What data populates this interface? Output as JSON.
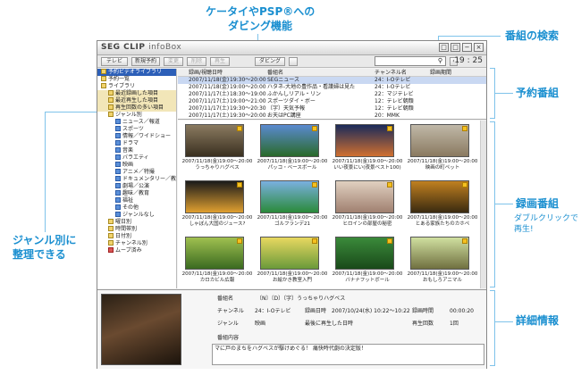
{
  "callouts": {
    "dubbing": [
      "ケータイやPSP®への",
      "ダビング機能"
    ],
    "search": "番組の検索",
    "reserved": "予約番組",
    "recorded": "録画番組",
    "recorded_sub": [
      "ダブルクリックで",
      "再生!"
    ],
    "genre": [
      "ジャンル別に",
      "整理できる"
    ],
    "detail": "詳細情報"
  },
  "app": {
    "logo_main": "SEG CLIP",
    "logo_sub": "infoBox",
    "clock": "19 : 25",
    "window_buttons": [
      "□",
      "□",
      "−",
      "×"
    ]
  },
  "toolbar": {
    "buttons": [
      "テレビ",
      "新規予約",
      "変更",
      "削除",
      "再生",
      "ダビング"
    ]
  },
  "tree": {
    "items": [
      {
        "label": "予約ビデオライブラリ",
        "style": "sel",
        "indent": 0
      },
      {
        "label": "予約一覧",
        "indent": 0
      },
      {
        "label": "ライブラリ",
        "indent": 0
      },
      {
        "label": "最近録画した項目",
        "style": "hl",
        "indent": 1
      },
      {
        "label": "最近再生した項目",
        "style": "hl",
        "indent": 1
      },
      {
        "label": "再生回数の多い項目",
        "style": "hl",
        "indent": 1
      },
      {
        "label": "ジャンル別",
        "indent": 1
      },
      {
        "label": "ニュース／報道",
        "indent": 2
      },
      {
        "label": "スポーツ",
        "indent": 2
      },
      {
        "label": "情報／ワイドショー",
        "indent": 2
      },
      {
        "label": "ドラマ",
        "indent": 2
      },
      {
        "label": "音楽",
        "indent": 2
      },
      {
        "label": "バラエティ",
        "indent": 2
      },
      {
        "label": "映画",
        "indent": 2
      },
      {
        "label": "アニメ／特撮",
        "indent": 2
      },
      {
        "label": "ドキュメンタリー／教養",
        "indent": 2
      },
      {
        "label": "劇場／公演",
        "indent": 2
      },
      {
        "label": "趣味／教育",
        "indent": 2
      },
      {
        "label": "福祉",
        "indent": 2
      },
      {
        "label": "その他",
        "indent": 2
      },
      {
        "label": "ジャンルなし",
        "indent": 2
      },
      {
        "label": "曜日別",
        "indent": 1
      },
      {
        "label": "時間帯別",
        "indent": 1
      },
      {
        "label": "日付別",
        "indent": 1
      },
      {
        "label": "チャンネル別",
        "indent": 1
      },
      {
        "label": "ムーブ済み",
        "indent": 1
      }
    ]
  },
  "reserved": {
    "headers": [
      "録画/視聴日時",
      "番組名",
      "チャンネル名",
      "録画期間"
    ],
    "rows": [
      [
        "2007/11/18(金)",
        "19:30〜20:00",
        "SEGニュース",
        "24：I-Oテレビ"
      ],
      [
        "2007/11/18(金)",
        "19:00〜20:00",
        "ハタネ-大地の豊作品・看護婦は見た",
        "24：I-Oテレビ"
      ],
      [
        "2007/11/17(土)",
        "18:30〜19:00",
        "ふかんしリアル・リン",
        "22：マジテレビ"
      ],
      [
        "2007/11/17(土)",
        "19:00〜21:00",
        "スポーツダイ・ボー",
        "12：テレビ朝顔"
      ],
      [
        "2007/11/17(土)",
        "19:30〜20:30",
        "〔字〕天気予報",
        "12：テレビ朝顔"
      ],
      [
        "2007/11/17(土)",
        "19:30〜20:00",
        "お天はPC講座",
        "20：MMK"
      ]
    ]
  },
  "recordings": [
    {
      "date": "2007/11/18(金)19:00〜20:00",
      "title": "うっちゃりハグベス"
    },
    {
      "date": "2007/11/18(金)19:00〜20:00",
      "title": "パッコ・ベースボール"
    },
    {
      "date": "2007/11/18(金)19:00〜20:00",
      "title": "いい夜景にい(夜景ベスト100)"
    },
    {
      "date": "2007/11/18(金)19:00〜20:00",
      "title": "映画の町ペット"
    },
    {
      "date": "2007/11/18(金)19:00〜20:00",
      "title": "しゃぼん大国のジュース?"
    },
    {
      "date": "2007/11/18(金)19:00〜20:00",
      "title": "ゴルフランデ21"
    },
    {
      "date": "2007/11/18(金)19:00〜20:00",
      "title": "ヒロインの部屋の秘密"
    },
    {
      "date": "2007/11/18(金)19:00〜20:00",
      "title": "とある家族たちのカホペ"
    },
    {
      "date": "2007/11/18(金)19:00〜20:00",
      "title": "カロカビル広報"
    },
    {
      "date": "2007/11/18(金)19:00〜20:00",
      "title": "お絵かき教室入門"
    },
    {
      "date": "2007/11/18(金)19:00〜20:00",
      "title": "バナナフットボール"
    },
    {
      "date": "2007/11/18(金)19:00〜20:00",
      "title": "おもしろアニマル"
    }
  ],
  "detail": {
    "title_label": "番組名",
    "title_value": "〔N〕〔D〕〔字〕うっちゃりハグベス",
    "channel_label": "チャンネル",
    "channel_value": "24：I-Oテレビ",
    "recdate_label": "録画日時",
    "recdate_value": "2007/10/24(水) 10:22〜10:22",
    "duration_label": "録画時間",
    "duration_value": "00:00:20",
    "genre_label": "ジャンル",
    "genre_value": "映画",
    "lastplay_label": "最後に再生した日時",
    "lastplay_value": "",
    "playcount_label": "再生回数",
    "playcount_value": "1回",
    "content_label": "番組内容",
    "content_value": "マに戸のまちをハグベスが駆けめぐる！ 痛快時代劇の決定版！"
  }
}
